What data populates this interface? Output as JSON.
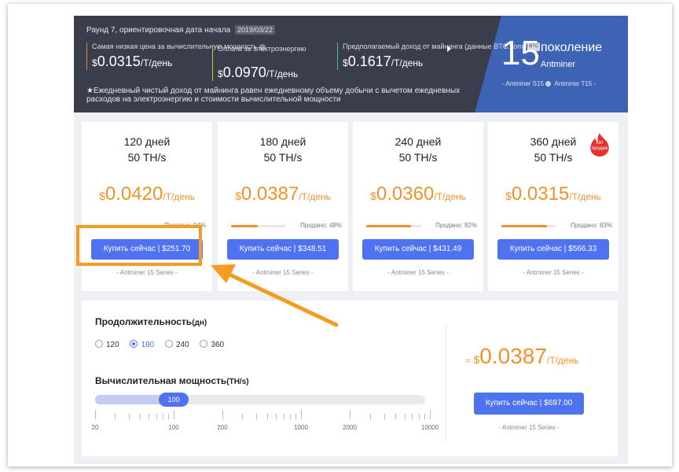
{
  "banner": {
    "round_text": "Раунд 7, ориентировочная дата начала",
    "date": "2019/03/22",
    "stats": [
      {
        "label": "Самая низкая цена за вычислительную мощность",
        "currency": "$",
        "amount": "0.0315",
        "unit": "/Т/день"
      },
      {
        "label": "Оплата за электроэнергию",
        "currency": "$",
        "amount": "0.0970",
        "unit": "/Т/день"
      },
      {
        "label": "Предполагаемый доход от майнинга (данные BTC.com)",
        "chip": "BTC",
        "currency": "$",
        "amount": "0.1617",
        "unit": "/Т/день"
      }
    ],
    "footnote": "★Ежедневный чистый доход от майнинга равен ежедневному объему добычи с вычетом ежедневных расходов на электроэнергию и стоимости вычислительной мощности",
    "generation": {
      "number": "15",
      "word": "поколение",
      "brand": "Antminer",
      "models": "- Antminer S15",
      "models2": "Antminer T15 -"
    }
  },
  "cards": [
    {
      "days": "120 дней",
      "power": "50 TH/s",
      "currency": "$",
      "amount": "0.0420",
      "unit": "/Т/день",
      "sold_label": "Продано: 94%",
      "sold": 0.94,
      "buy": "Купить сейчас | $251.70",
      "series": "- Antminer 15 Series -"
    },
    {
      "days": "180 дней",
      "power": "50 TH/s",
      "currency": "$",
      "amount": "0.0387",
      "unit": "/Т/день",
      "sold_label": "Продано: 48%",
      "sold": 0.48,
      "buy": "Купить сейчас | $348.51",
      "series": "- Antminer 15 Series -"
    },
    {
      "days": "240 дней",
      "power": "50 TH/s",
      "currency": "$",
      "amount": "0.0360",
      "unit": "/Т/день",
      "sold_label": "Продано: 82%",
      "sold": 0.82,
      "buy": "Купить сейчас | $431.49",
      "series": "- Antminer 15 Series -"
    },
    {
      "days": "360 дней",
      "power": "50 TH/s",
      "currency": "$",
      "amount": "0.0315",
      "unit": "/Т/день",
      "sold_label": "Продано: 83%",
      "sold": 0.83,
      "buy": "Купить сейчас | $566.33",
      "series": "- Antminer 15 Series -",
      "badge": "Хит продаж"
    }
  ],
  "calculator": {
    "duration_title": "Продолжительность",
    "duration_unit": "(дн)",
    "durations": [
      "120",
      "180",
      "240",
      "360"
    ],
    "selected_duration": "180",
    "power_title": "Вычислительная мощность",
    "power_unit": "(TH/s)",
    "slider_value": "100",
    "tick_labels": [
      "20",
      "100",
      "200",
      "1000",
      "2000",
      "10000"
    ],
    "approx": "≈",
    "currency": "$",
    "amount": "0.0387",
    "unit": "/Т/день",
    "buy": "Купить сейчас | $697.00",
    "series": "- Antminer 15 Series -"
  },
  "colors": {
    "accent": "#4f73f0",
    "price": "#f0922c",
    "highlight": "#f39c1f",
    "banner": "#3a3d4b",
    "banner_blue": "#3f63b4"
  }
}
